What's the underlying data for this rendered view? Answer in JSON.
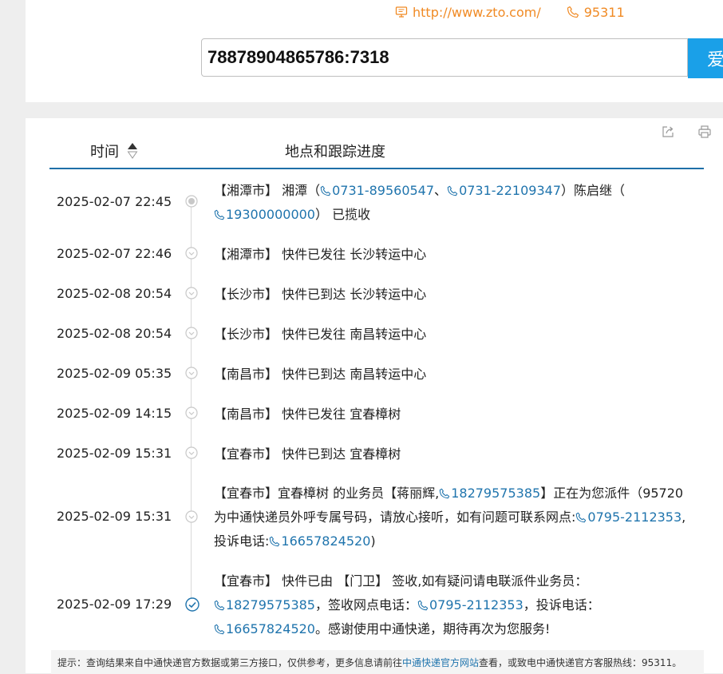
{
  "header": {
    "website": "http://www.zto.com/",
    "hotline": "95311",
    "tracking_input": "78878904865786:7318",
    "search_button": "爱"
  },
  "table": {
    "col_time": "时间",
    "col_location": "地点和跟踪进度"
  },
  "events": [
    {
      "time": "2025-02-07 22:45",
      "status": "collected",
      "city": "【湘潭市】",
      "s1": " 湘潭（",
      "tel1": "0731-89560547",
      "s2": "、",
      "tel2": "0731-22109347",
      "s3": "）陈启继（",
      "tel3": "19300000000",
      "s4": "） 已揽收"
    },
    {
      "time": "2025-02-07 22:46",
      "status": "transit",
      "city": "【湘潭市】",
      "text": " 快件已发往 长沙转运中心"
    },
    {
      "time": "2025-02-08 20:54",
      "status": "transit",
      "city": "【长沙市】",
      "text": " 快件已到达 长沙转运中心"
    },
    {
      "time": "2025-02-08 20:54",
      "status": "transit",
      "city": "【长沙市】",
      "text": " 快件已发往 南昌转运中心"
    },
    {
      "time": "2025-02-09 05:35",
      "status": "transit",
      "city": "【南昌市】",
      "text": " 快件已到达 南昌转运中心"
    },
    {
      "time": "2025-02-09 14:15",
      "status": "transit",
      "city": "【南昌市】",
      "text": " 快件已发往 宜春樟树"
    },
    {
      "time": "2025-02-09 15:31",
      "status": "transit",
      "city": "【宜春市】",
      "text": " 快件已到达 宜春樟树"
    },
    {
      "time": "2025-02-09 15:31",
      "status": "transit",
      "city": "【宜春市】",
      "s1": "宜春樟树 的业务员【蒋丽辉,",
      "tel1": "18279575385",
      "s2": "】正在为您派件（95720为中通快递员外呼专属号码，请放心接听，如有问题可联系网点:",
      "tel2": "0795-2112353",
      "s3": ",投诉电话:",
      "tel3": "16657824520",
      "s4": ")"
    },
    {
      "time": "2025-02-09 17:29",
      "status": "signed",
      "city": "【宜春市】",
      "s1": " 快件已由 【门卫】 签收,如有疑问请电联派件业务员：",
      "tel1": "18279575385",
      "s2": "，签收网点电话：",
      "tel2": "0795-2112353",
      "s3": "，投诉电话：",
      "tel3": "16657824520",
      "s4": "。感谢使用中通快递，期待再次为您服务!"
    }
  ],
  "hint": {
    "prefix": "提示：查询结果来自中通快递官方数据或第三方接口，仅供参考，更多信息请前往",
    "link": "中通快递官方网站",
    "suffix": "查看，或致电中通快递官方客服热线：95311。"
  }
}
